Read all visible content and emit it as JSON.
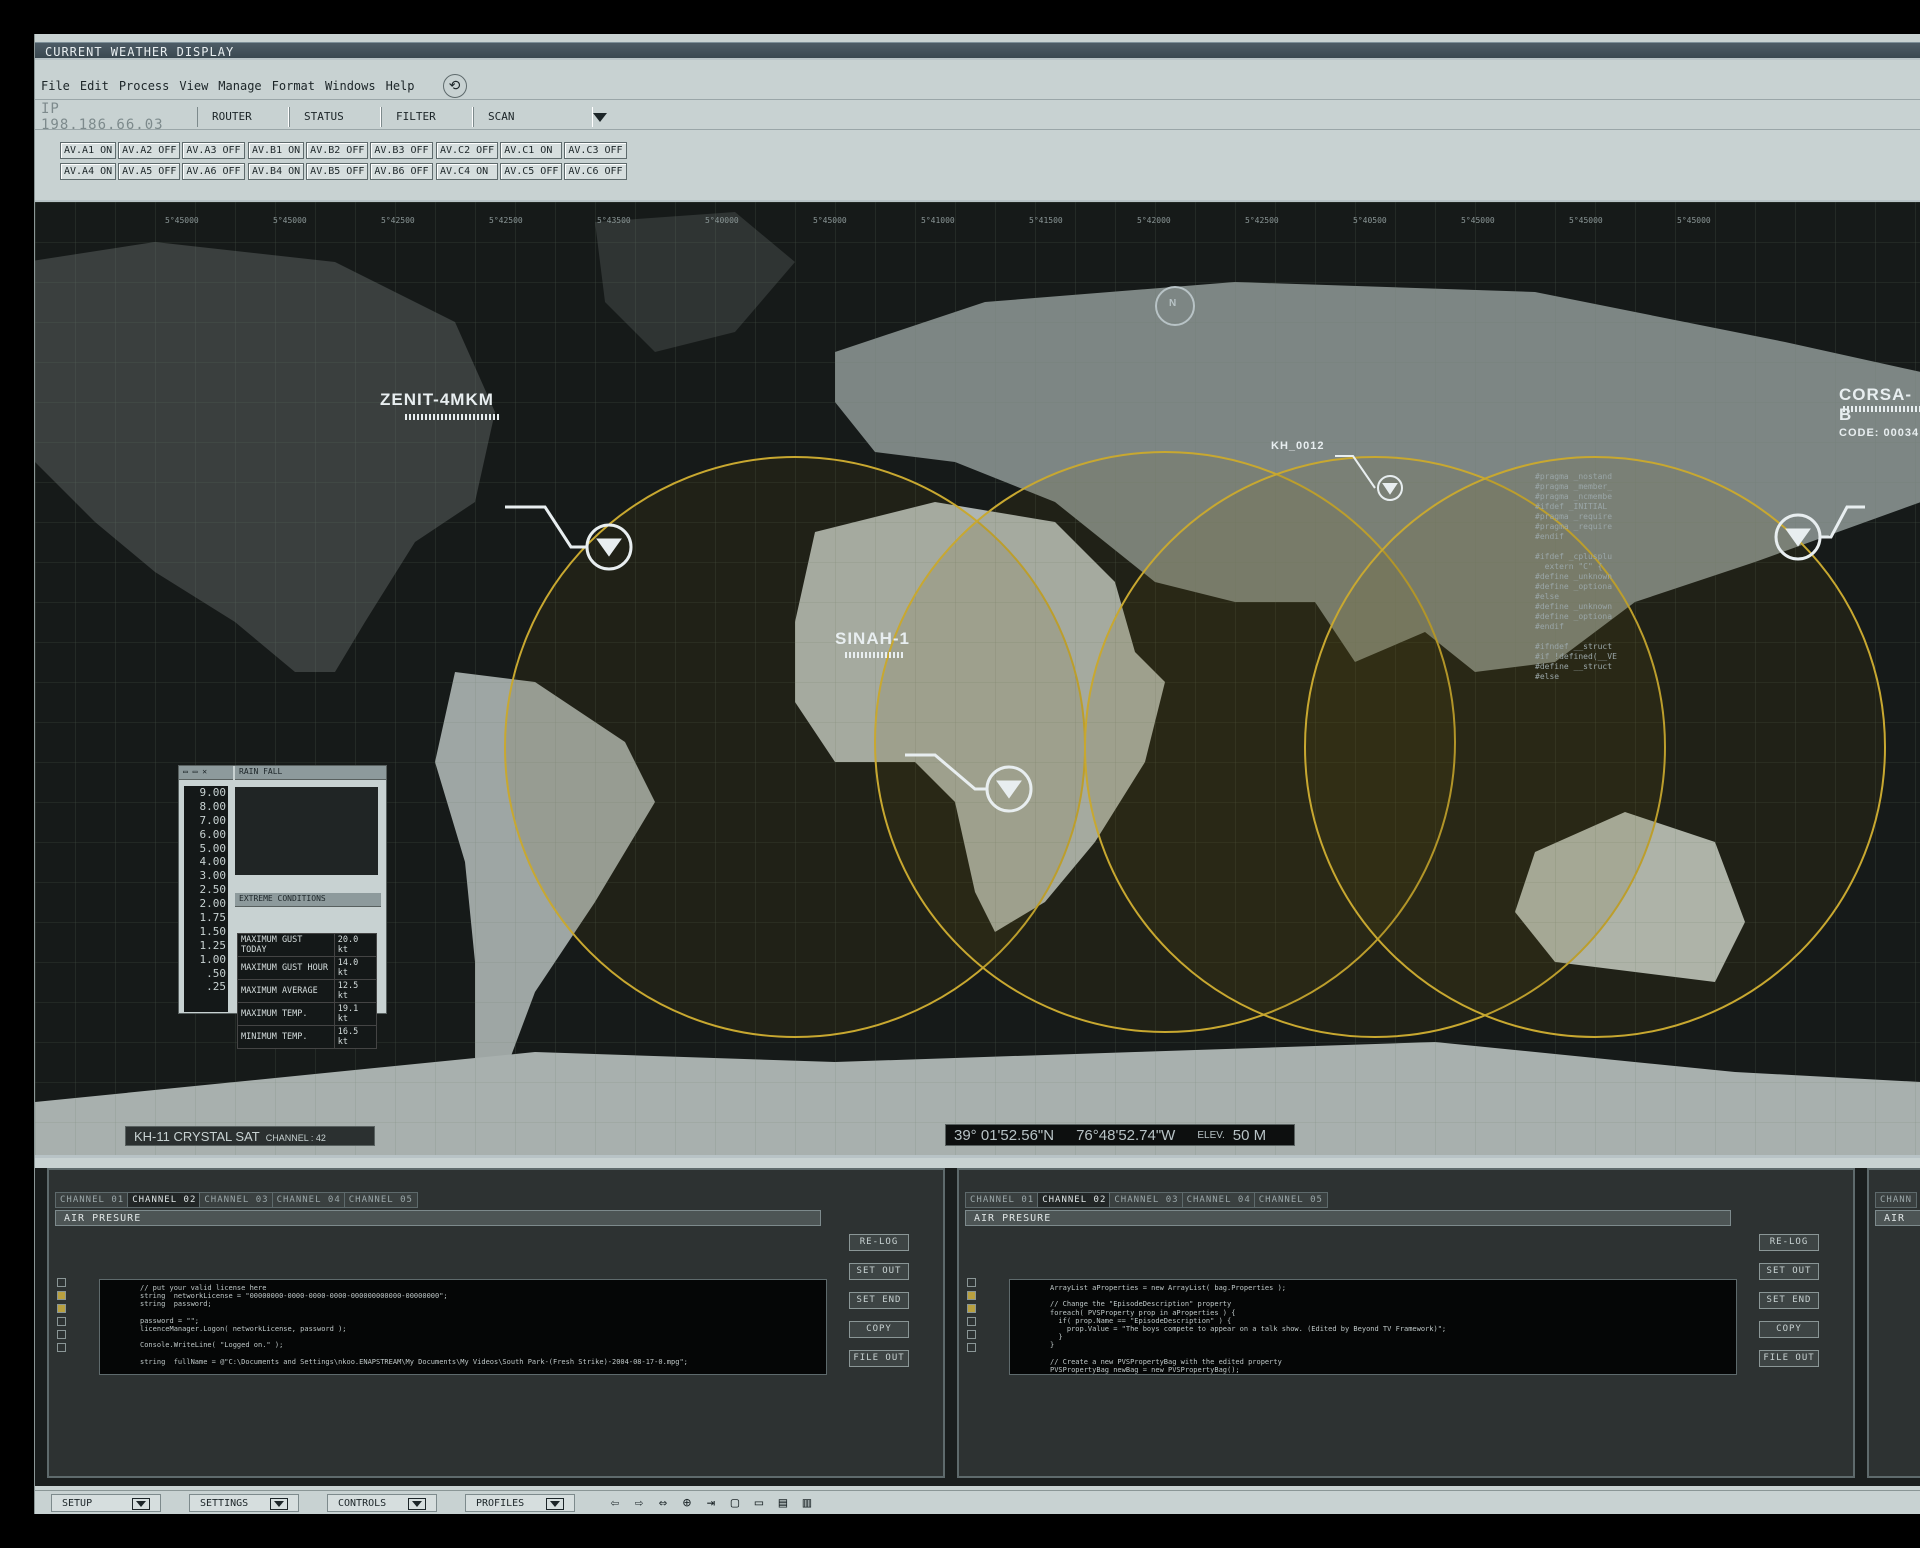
{
  "window": {
    "title": "CURRENT WEATHER DISPLAY"
  },
  "menu": [
    "File",
    "Edit",
    "Process",
    "View",
    "Manage",
    "Format",
    "Windows",
    "Help"
  ],
  "toolbar": {
    "ip": "IP 198.186.66.03",
    "router": "ROUTER",
    "status": "STATUS",
    "filter": "FILTER",
    "scan": "SCAN"
  },
  "av": {
    "g1": [
      "AV.A1 ON",
      "AV.A2 OFF",
      "AV.A3 OFF",
      "AV.A4 ON",
      "AV.A5 OFF",
      "AV.A6 OFF"
    ],
    "g2": [
      "AV.B1 ON",
      "AV.B2 OFF",
      "AV.B3 OFF",
      "AV.B4 ON",
      "AV.B5 OFF",
      "AV.B6 OFF"
    ],
    "g3": [
      "AV.C2 OFF",
      "AV.C1 ON",
      "AV.C3 OFF",
      "AV.C4 ON",
      "AV.C5 OFF",
      "AV.C6 OFF"
    ]
  },
  "map": {
    "satellites": [
      {
        "name": "ZENIT-4MKM"
      },
      {
        "name": "SINAH-1"
      },
      {
        "name": "KH_0012"
      },
      {
        "name": "CORSA-B",
        "code": "CODE: 00034"
      }
    ],
    "compass": "N",
    "kh": {
      "name": "KH-11 CRYSTAL SAT",
      "channel": "CHANNEL : 42"
    },
    "coords": {
      "lat": "39° 01'52.56\"N",
      "lon": "76°48'52.74\"W",
      "elev_label": "ELEV.",
      "elev": "50 M"
    },
    "lat_ticks": [
      "5°45000",
      "5°45000",
      "5°42500",
      "5°42500",
      "5°43500",
      "5°40000",
      "5°45000",
      "5°41000",
      "5°41500",
      "5°42000",
      "5°42500",
      "5°40500",
      "5°45000",
      "5°45000",
      "5°45000"
    ]
  },
  "rain": {
    "title": "RAIN FALL",
    "scale": [
      "9.00",
      "8.00",
      "7.00",
      "6.00",
      "5.00",
      "4.00",
      "3.00",
      "2.50",
      "2.00",
      "1.75",
      "1.50",
      "1.25",
      "1.00",
      ".50",
      ".25"
    ],
    "extreme": {
      "title": "EXTREME CONDITIONS",
      "rows": [
        [
          "MAXIMUM GUST TODAY",
          "20.0 kt"
        ],
        [
          "MAXIMUM GUST HOUR",
          "14.0 kt"
        ],
        [
          "MAXIMUM AVERAGE",
          "12.5 kt"
        ],
        [
          "MAXIMUM TEMP.",
          "19.1 kt"
        ],
        [
          "MINIMUM TEMP.",
          "16.5 kt"
        ]
      ]
    }
  },
  "code_right": "#pragma _nostand\n#pragma _member_\n#pragma _ncmembe\n#ifdef _INITIAL\n#pragma _require\n#pragma _require\n#endif\n\n#ifdef _cplusplu\n  extern \"C\" {\n#define _unknown\n#define _optiona\n#else\n#define _unknown\n#define _optiona\n#endif\n\n#ifndef __struct\n#if !defined(__VE\n#define __struct\n#else",
  "panels": [
    {
      "tabs": [
        "CHANNEL 01",
        "CHANNEL 02",
        "CHANNEL 03",
        "CHANNEL 04",
        "CHANNEL 05"
      ],
      "active": 1,
      "header": "AIR PRESURE",
      "code": "// put your valid license here\nstring  networkLicense = \"00000000-0000-0000-0000-000000000000-00000000\";\nstring  password;\n\npassword = \"\";\nlicenceManager.Logon( networkLicense, password );\n\nConsole.WriteLine( \"Logged on.\" );\n\nstring  fullName = @\"C:\\Documents and Settings\\nkoo.ENAPSTREAM\\My Documents\\My Videos\\South Park-(Fresh Strike)-2004-08-17-0.mpg\";\n\nBTVLibrary library = new BTVLibrary();\n\n// Get properties\nPVSPropertyBag bag = library.GetMediaByFullName( fullName );"
    },
    {
      "tabs": [
        "CHANNEL 01",
        "CHANNEL 02",
        "CHANNEL 03",
        "CHANNEL 04",
        "CHANNEL 05"
      ],
      "active": 1,
      "header": "AIR PRESURE",
      "code": "ArrayList aProperties = new ArrayList( bag.Properties );\n\n// Change the \"EpisodeDescription\" property\nforeach( PVSProperty prop in aProperties ) {\n  if( prop.Name == \"EpisodeDescription\" ) {\n    prop.Value = \"The boys compete to appear on a talk show. (Edited by Beyond TV Framework)\";\n  }\n}\n\n// Create a new PVSPropertyBag with the edited property\nPVSPropertyBag newBag = new PVSPropertyBag();\nnewBag.Properties = (PVSProperty[])aProperties.ToArray( typeof(PVSProperty) );\n\n// This method will edit the recording\nlibrary.EditMedia( fullName, newBag );"
    }
  ],
  "panel3": {
    "tab": "CHANN",
    "header": "AIR"
  },
  "side_buttons": [
    "RE-LOG",
    "SET OUT",
    "SET END",
    "COPY",
    "FILE OUT"
  ],
  "statusbar": [
    "SETUP",
    "SETTINGS",
    "CONTROLS",
    "PROFILES"
  ],
  "icons": [
    "⇦",
    "⇨",
    "⇔",
    "⊕",
    "⇥",
    "▢",
    "▭",
    "▤",
    "▥"
  ]
}
